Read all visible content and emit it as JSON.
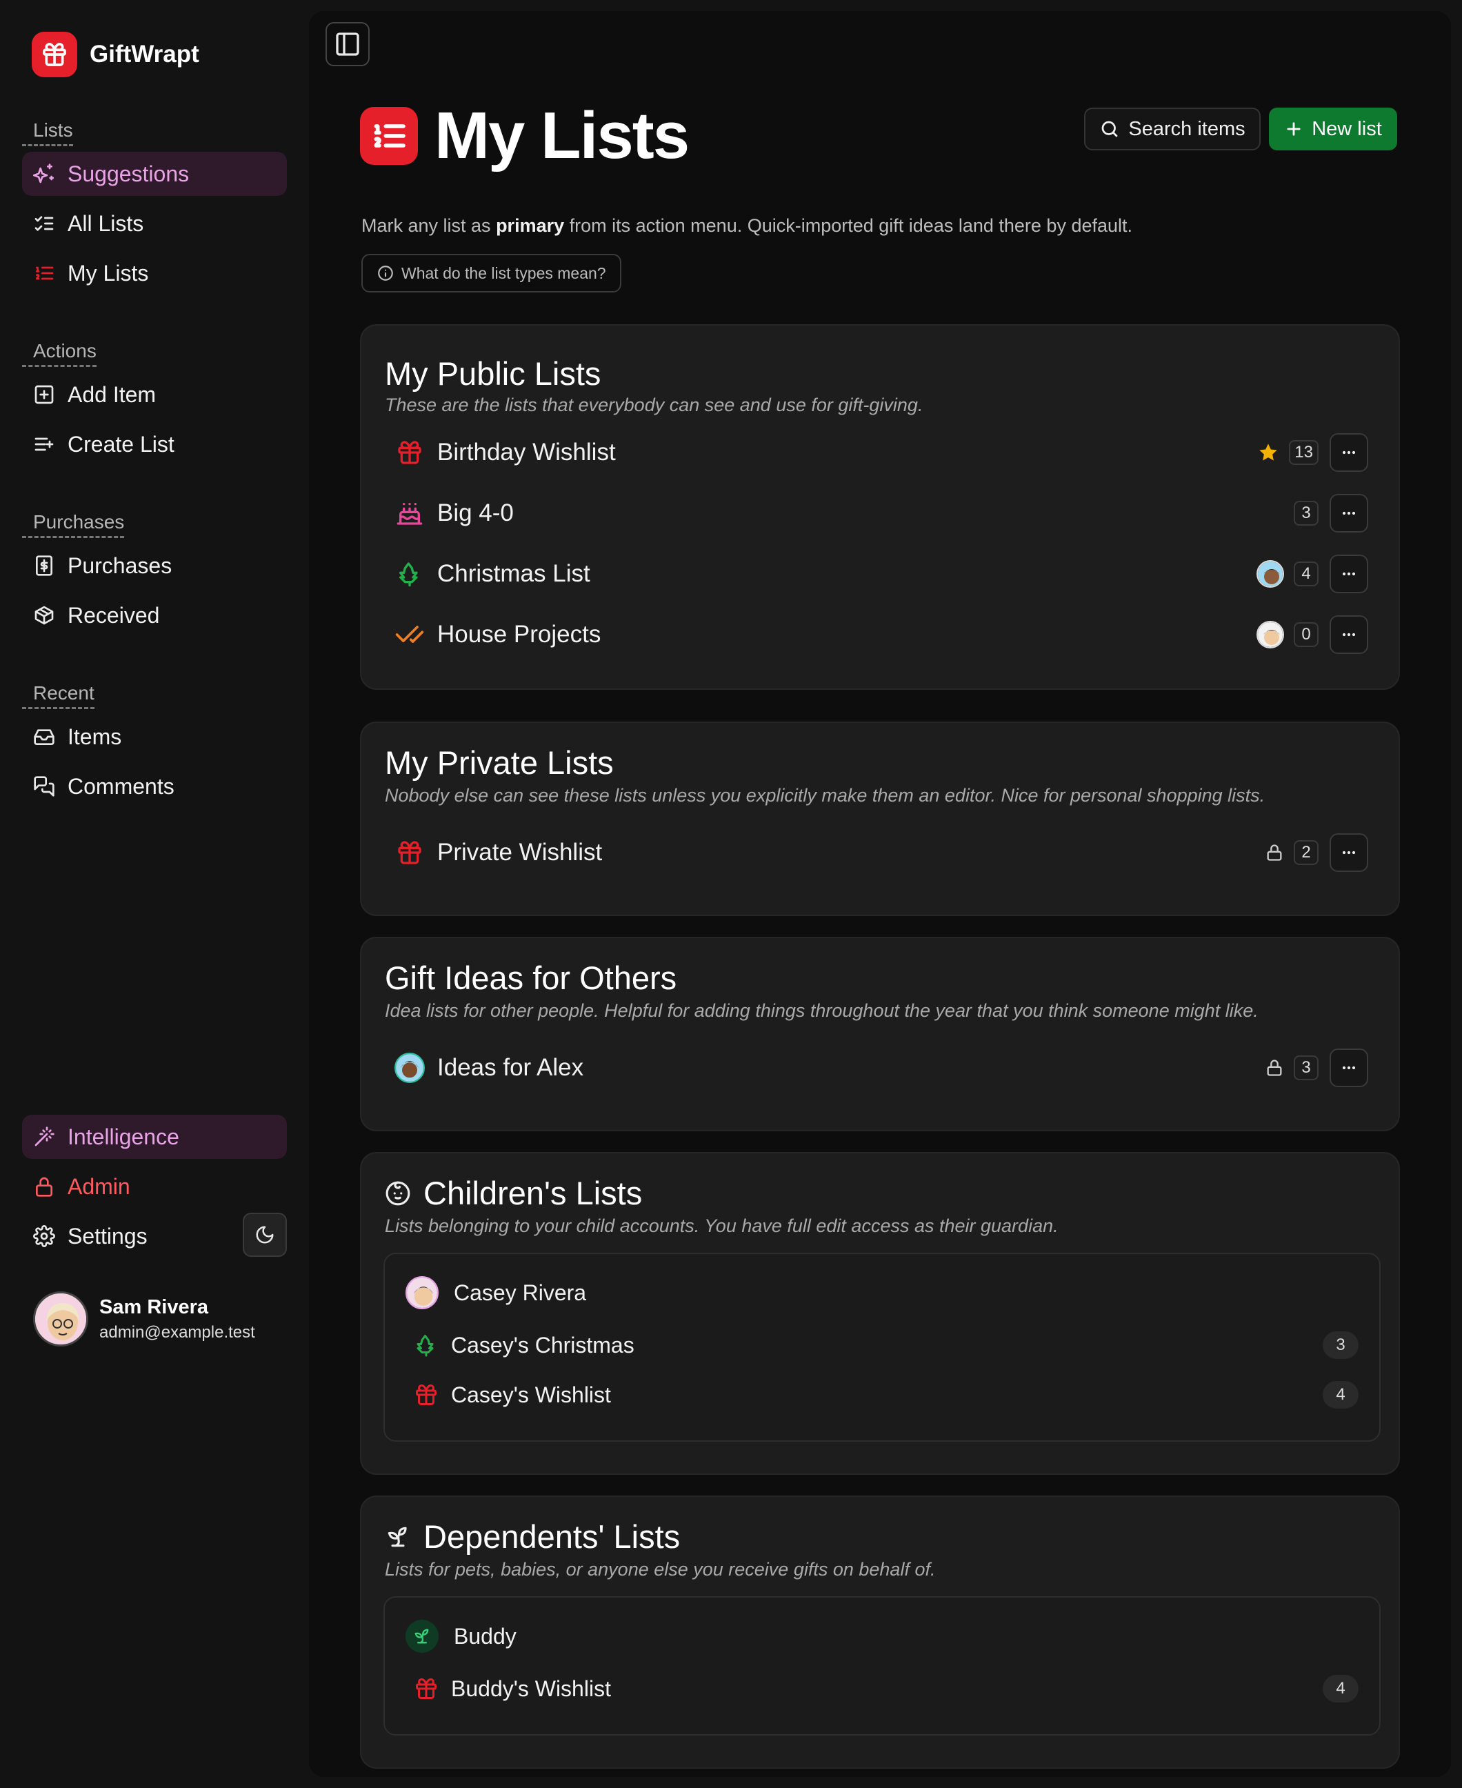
{
  "app": {
    "name": "GiftWrapt"
  },
  "sidebar": {
    "groups": [
      {
        "label": "Lists",
        "items": [
          {
            "label": "Suggestions",
            "icon": "sparkles-icon"
          },
          {
            "label": "All Lists",
            "icon": "list-checks-icon"
          },
          {
            "label": "My Lists",
            "icon": "list-ordered-icon"
          }
        ]
      },
      {
        "label": "Actions",
        "items": [
          {
            "label": "Add Item",
            "icon": "plus-square-icon"
          },
          {
            "label": "Create List",
            "icon": "list-plus-icon"
          }
        ]
      },
      {
        "label": "Purchases",
        "items": [
          {
            "label": "Purchases",
            "icon": "receipt-icon"
          },
          {
            "label": "Received",
            "icon": "package-icon"
          }
        ]
      },
      {
        "label": "Recent",
        "items": [
          {
            "label": "Items",
            "icon": "inbox-icon"
          },
          {
            "label": "Comments",
            "icon": "messages-icon"
          }
        ]
      }
    ],
    "bottom": [
      {
        "label": "Intelligence",
        "icon": "wand-icon"
      },
      {
        "label": "Admin",
        "icon": "lock-icon"
      },
      {
        "label": "Settings",
        "icon": "gear-icon"
      }
    ],
    "user": {
      "name": "Sam Rivera",
      "email": "admin@example.test"
    }
  },
  "header": {
    "title": "My Lists",
    "search_label": "Search items",
    "new_label": "New list",
    "subtitle_pre": "Mark any list as ",
    "subtitle_bold": "primary",
    "subtitle_post": " from its action menu. Quick-imported gift ideas land there by default.",
    "help_label": "What do the list types mean?"
  },
  "sections": {
    "public": {
      "title": "My Public Lists",
      "desc": "These are the lists that everybody can see and use for gift-giving.",
      "rows": [
        {
          "name": "Birthday Wishlist",
          "count": "13",
          "icon": "gift-icon",
          "primary": true
        },
        {
          "name": "Big 4-0",
          "count": "3",
          "icon": "cake-icon"
        },
        {
          "name": "Christmas List",
          "count": "4",
          "icon": "tree-icon",
          "shared": true
        },
        {
          "name": "House Projects",
          "count": "0",
          "icon": "check-check-icon",
          "shared": true
        }
      ]
    },
    "private": {
      "title": "My Private Lists",
      "desc": "Nobody else can see these lists unless you explicitly make them an editor. Nice for personal shopping lists.",
      "rows": [
        {
          "name": "Private Wishlist",
          "count": "2",
          "icon": "gift-icon"
        }
      ]
    },
    "others": {
      "title": "Gift Ideas for Others",
      "desc": "Idea lists for other people. Helpful for adding things throughout the year that you think someone might like.",
      "rows": [
        {
          "name": "Ideas for Alex",
          "count": "3",
          "icon": "avatar"
        }
      ]
    },
    "children": {
      "title": "Children's Lists",
      "desc": "Lists belonging to your child accounts. You have full edit access as their guardian.",
      "owner": "Casey Rivera",
      "rows": [
        {
          "name": "Casey's Christmas",
          "count": "3",
          "icon": "tree-icon"
        },
        {
          "name": "Casey's Wishlist",
          "count": "4",
          "icon": "gift-icon"
        }
      ]
    },
    "dependents": {
      "title": "Dependents' Lists",
      "desc": "Lists for pets, babies, or anyone else you receive gifts on behalf of.",
      "owner": "Buddy",
      "rows": [
        {
          "name": "Buddy's Wishlist",
          "count": "4",
          "icon": "gift-icon"
        }
      ]
    }
  },
  "colors": {
    "accent_red": "#e5202a",
    "accent_green": "#0e7a2f",
    "active_bg": "#2e1a2a",
    "active_text": "#e9a3e6",
    "star": "#f5b301"
  }
}
